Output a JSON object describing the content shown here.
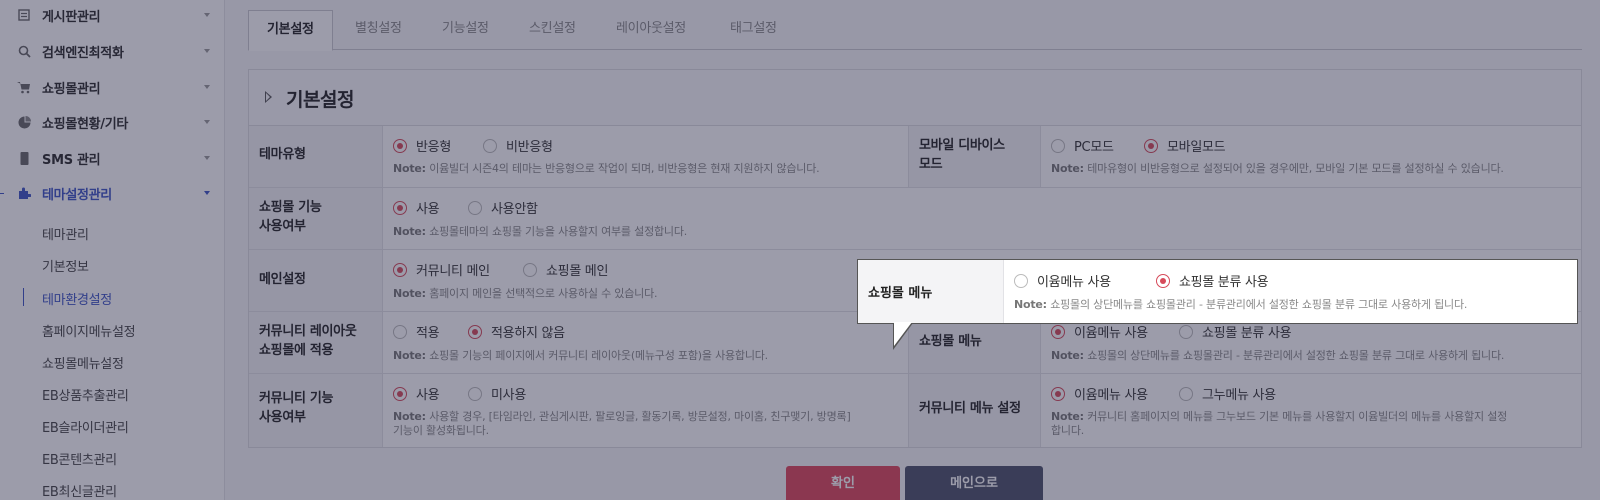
{
  "sidebar": {
    "items": [
      {
        "label": "게시판관리",
        "icon": "board-icon"
      },
      {
        "label": "검색엔진최적화",
        "icon": "search-icon"
      },
      {
        "label": "쇼핑몰관리",
        "icon": "cart-icon"
      },
      {
        "label": "쇼핑몰현황/기타",
        "icon": "pie-chart-icon"
      },
      {
        "label": "SMS 관리",
        "icon": "phone-icon"
      },
      {
        "label": "테마설정관리",
        "icon": "puzzle-icon"
      }
    ],
    "subitems": [
      "테마관리",
      "기본정보",
      "테마환경설정",
      "홈페이지메뉴설정",
      "쇼핑몰메뉴설정",
      "EB상품추출관리",
      "EB슬라이더관리",
      "EB콘텐츠관리",
      "EB최신글관리"
    ]
  },
  "tabs": [
    "기본설정",
    "별칭설정",
    "기능설정",
    "스킨설정",
    "레이아웃설정",
    "태그설정"
  ],
  "panel": {
    "title": "기본설정"
  },
  "rows": {
    "theme_type": {
      "label": "테마유형",
      "opt1": "반응형",
      "opt2": "비반응형",
      "note_prefix": "Note:",
      "note": "이윰빌더 시즌4의 테마는 반응형으로 작업이 되며, 비반응형은 현재 지원하지 않습니다."
    },
    "mobile_mode": {
      "label_line1": "모바일 디바이스",
      "label_line2": "모드",
      "opt1": "PC모드",
      "opt2": "모바일모드",
      "note_prefix": "Note:",
      "note": "테마유형이 비반응형으로 설정되어 있을 경우에만, 모바일 기본 모드를 설정하실 수 있습니다."
    },
    "shop_use": {
      "label_line1": "쇼핑몰 기능",
      "label_line2": "사용여부",
      "opt1": "사용",
      "opt2": "사용안함",
      "note_prefix": "Note:",
      "note": "쇼핑몰테마의 쇼핑몰 기능을 사용할지 여부를 설정합니다."
    },
    "main_setting": {
      "label": "메인설정",
      "opt1": "커뮤니티 메인",
      "opt2": "쇼핑몰 메인",
      "note_prefix": "Note:",
      "note": "홈페이지 메인을 선택적으로 사용하실 수 있습니다."
    },
    "community_layout": {
      "label_line1": "커뮤니티 레이아웃",
      "label_line2": "쇼핑몰에 적용",
      "opt1": "적용",
      "opt2": "적용하지 않음",
      "note_prefix": "Note:",
      "note": "쇼핑몰 기능의 페이지에서 커뮤니티 레이아웃(메뉴구성 포함)을 사용합니다."
    },
    "shop_menu": {
      "label": "쇼핑몰 메뉴",
      "opt1": "이윰메뉴 사용",
      "opt2": "쇼핑몰 분류 사용",
      "note_prefix": "Note:",
      "note": "쇼핑몰의 상단메뉴를 쇼핑몰관리 - 분류관리에서 설정한 쇼핑몰 분류 그대로 사용하게 됩니다."
    },
    "community_use": {
      "label_line1": "커뮤니티 기능",
      "label_line2": "사용여부",
      "opt1": "사용",
      "opt2": "미사용",
      "note_prefix": "Note:",
      "note_line1": "사용할 경우, [타임라인, 관심게시판, 팔로잉글, 활동기록, 방문설정, 마이홈, 친구맺기, 방명록]",
      "note_line2": "기능이 활성화됩니다."
    },
    "community_menu": {
      "label": "커뮤니티 메뉴 설정",
      "opt1": "이윰메뉴 사용",
      "opt2": "그누메뉴 사용",
      "note_prefix": "Note:",
      "note_line1": "커뮤니티 홈페이지의 메뉴를 그누보드 기본 메뉴를 사용할지 이윰빌더의 메뉴를 사용할지 설정",
      "note_line2": "합니다."
    }
  },
  "buttons": {
    "confirm": "확인",
    "main": "메인으로"
  },
  "tooltip": {
    "label": "쇼핑몰 메뉴",
    "opt1": "이윰메뉴 사용",
    "opt2": "쇼핑몰 분류 사용",
    "note_prefix": "Note:",
    "note": "쇼핑몰의 상단메뉴를 쇼핑몰관리 - 분류관리에서 설정한 쇼핑몰 분류 그대로 사용하게 됩니다."
  },
  "colors": {
    "accent": "#3b53c5",
    "radio": "#d64a5a",
    "confirm": "#e0455a",
    "main_btn": "#4a5068"
  }
}
